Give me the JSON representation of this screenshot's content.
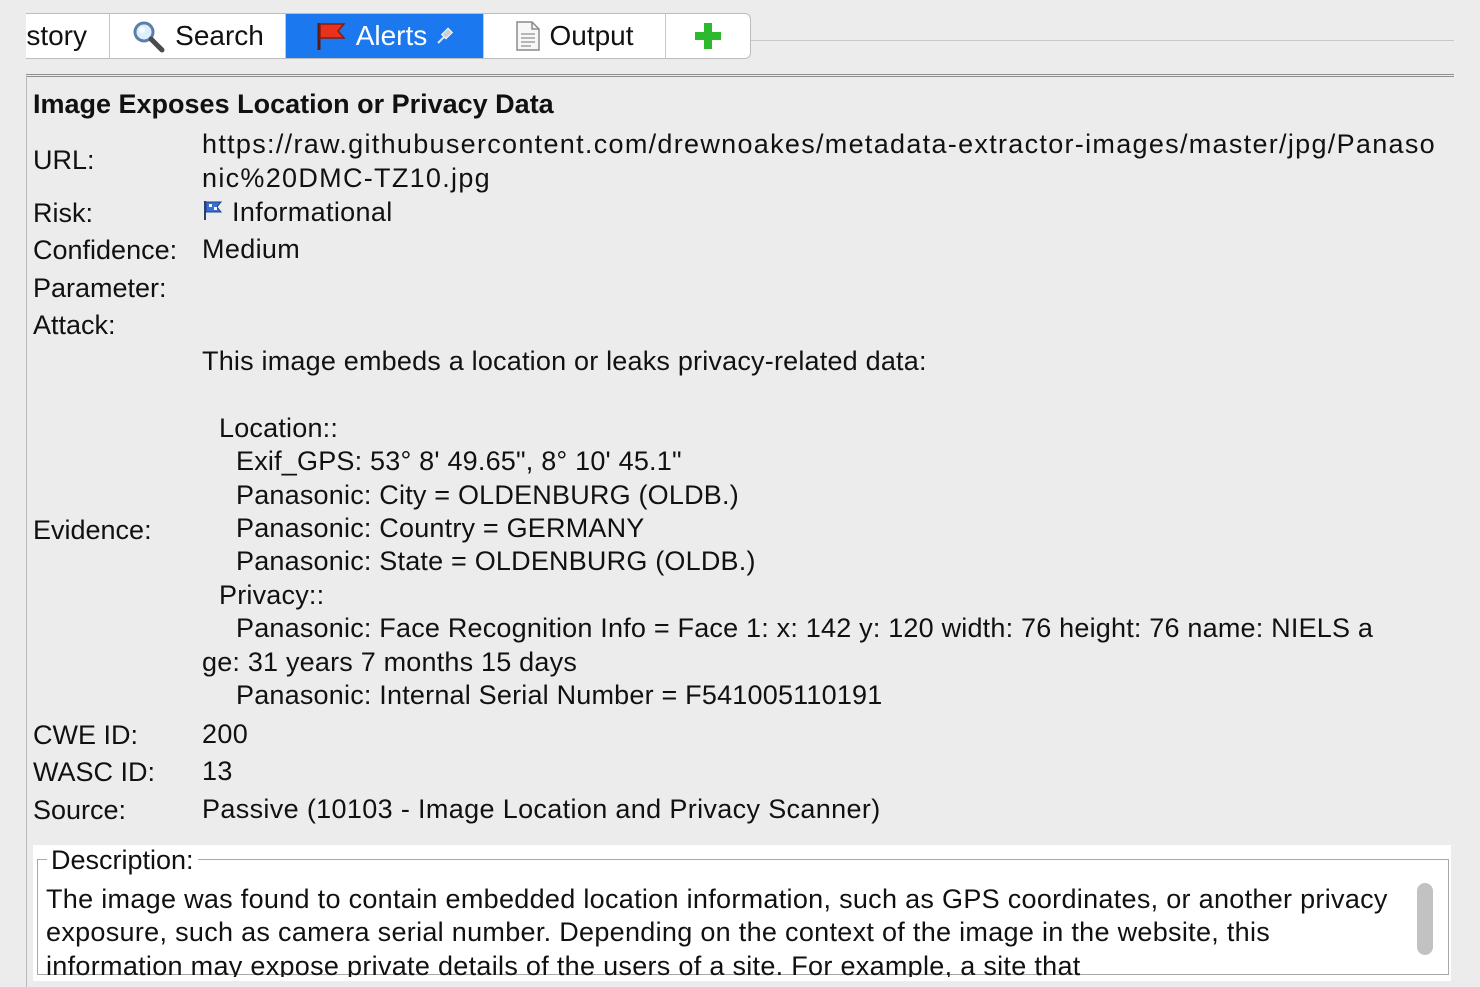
{
  "tabs": {
    "history": "story",
    "search": "Search",
    "alerts": "Alerts",
    "output": "Output"
  },
  "alert": {
    "title": "Image Exposes Location or Privacy Data",
    "labels": {
      "url": "URL:",
      "risk": "Risk:",
      "confidence": "Confidence:",
      "parameter": "Parameter:",
      "attack": "Attack:",
      "evidence": "Evidence:",
      "cwe": "CWE ID:",
      "wasc": "WASC ID:",
      "source": "Source:"
    },
    "url": "https://raw.githubusercontent.com/drewnoakes/metadata-extractor-images/master/jpg/Panasonic%20DMC-TZ10.jpg",
    "risk": "Informational",
    "confidence": "Medium",
    "parameter": "",
    "attack": "",
    "evidence": {
      "intro": "This image embeds a location or leaks privacy-related data:",
      "location_header": "Location::",
      "exif_gps": "Exif_GPS: 53° 8' 49.65\", 8° 10' 45.1\"",
      "city": "Panasonic: City = OLDENBURG (OLDB.)",
      "country": "Panasonic: Country = GERMANY",
      "state": "Panasonic: State = OLDENBURG (OLDB.)",
      "privacy_header": "Privacy::",
      "face_line1": "Panasonic: Face Recognition Info = Face 1: x: 142 y: 120 width: 76 height: 76 name: NIELS a",
      "face_line2": "ge: 31 years 7 months 15 days",
      "serial": "Panasonic: Internal Serial Number = F541005110191"
    },
    "cwe_id": "200",
    "wasc_id": "13",
    "source": "Passive (10103 - Image Location and Privacy Scanner)"
  },
  "description": {
    "legend": "Description:",
    "text": "The image was found to contain embedded location information, such as GPS coordinates, or another privacy exposure, such as camera serial number.  Depending on the context of the image in the website, this information may expose private details of the users of a site.  For example, a site that"
  },
  "icons": {
    "search": "magnifier-icon",
    "alerts": "red-flag-icon",
    "pin": "pin-icon",
    "output": "document-icon",
    "add": "green-plus-icon",
    "risk": "blue-flag-icon"
  },
  "colors": {
    "active_tab": "#1c78ef",
    "add_icon": "#2db82d",
    "risk_flag": "#3a6fd8"
  }
}
